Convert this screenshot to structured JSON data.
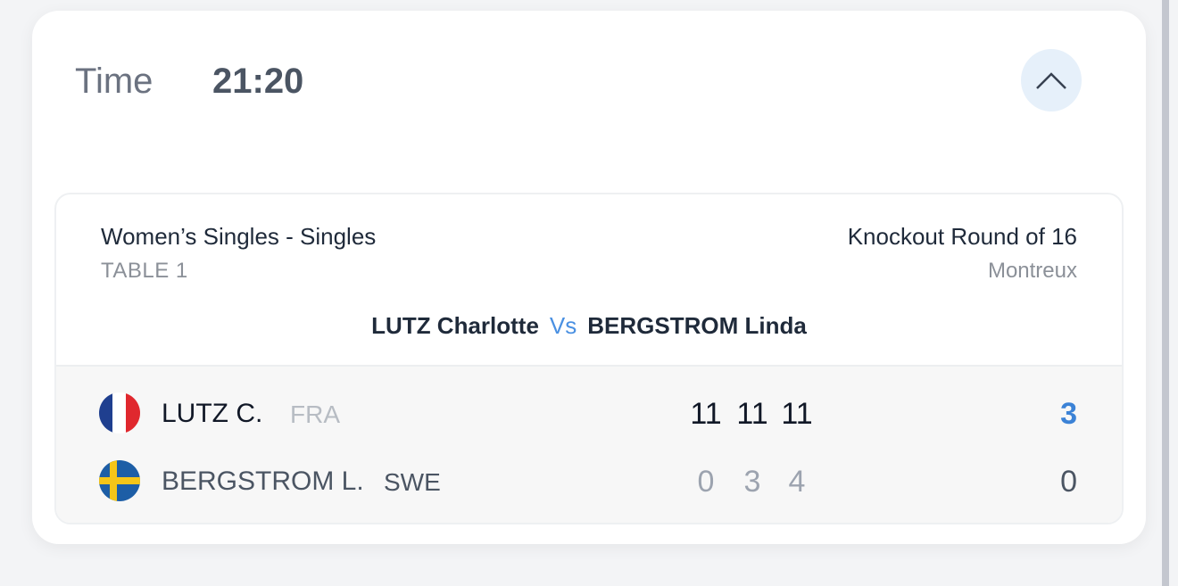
{
  "time": {
    "label": "Time",
    "value": "21:20"
  },
  "match": {
    "event": "Women’s Singles - Singles",
    "table": "TABLE 1",
    "round": "Knockout Round of 16",
    "venue": "Montreux",
    "player1_full": "LUTZ Charlotte",
    "vs": "Vs",
    "player2_full": "BERGSTROM Linda"
  },
  "players": [
    {
      "name": "LUTZ C.",
      "country": "FRA",
      "games": [
        "11",
        "11",
        "11"
      ],
      "total": "3"
    },
    {
      "name": "BERGSTROM L.",
      "country": "SWE",
      "games": [
        "0",
        "3",
        "4"
      ],
      "total": "0"
    }
  ],
  "colors": {
    "accent": "#4a90e2",
    "winner_total": "#3b82d6",
    "collapse_bg": "#e6f0fa"
  },
  "icons": {
    "collapse": "chevron-up-icon",
    "flag1": "france-flag-icon",
    "flag2": "sweden-flag-icon"
  }
}
